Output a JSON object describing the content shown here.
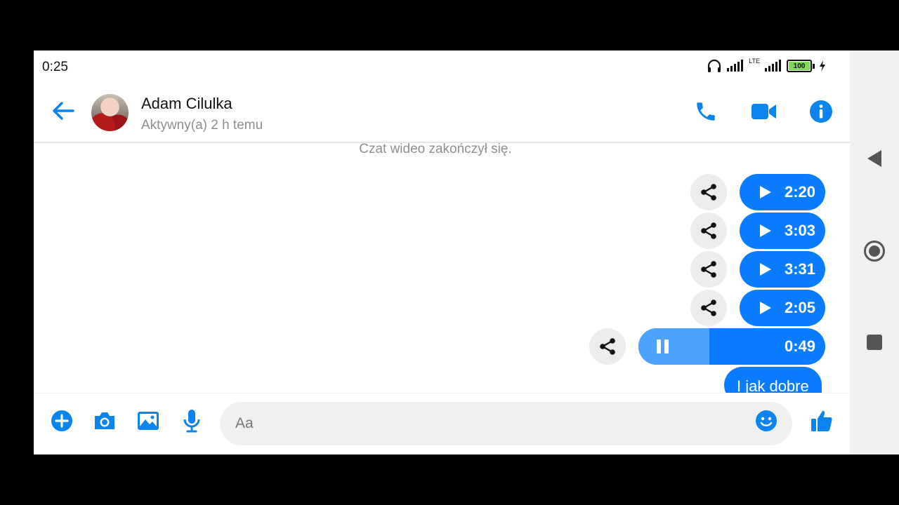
{
  "status_bar": {
    "time": "0:25",
    "network": "LTE",
    "battery": "100"
  },
  "header": {
    "contact_name": "Adam Cilulka",
    "contact_status": "Aktywny(a) 2 h temu"
  },
  "chat": {
    "system_message": "Czat wideo zakończył się.",
    "audio_messages": [
      {
        "duration": "2:20",
        "state": "play"
      },
      {
        "duration": "3:03",
        "state": "play"
      },
      {
        "duration": "3:31",
        "state": "play"
      },
      {
        "duration": "2:05",
        "state": "play"
      },
      {
        "duration": "0:49",
        "state": "pause",
        "progress": 0.38
      }
    ],
    "text_message": "I jak dobre"
  },
  "composer": {
    "placeholder": "Aa"
  },
  "colors": {
    "accent": "#0a7cff",
    "icon_blue": "#0b84ee"
  }
}
